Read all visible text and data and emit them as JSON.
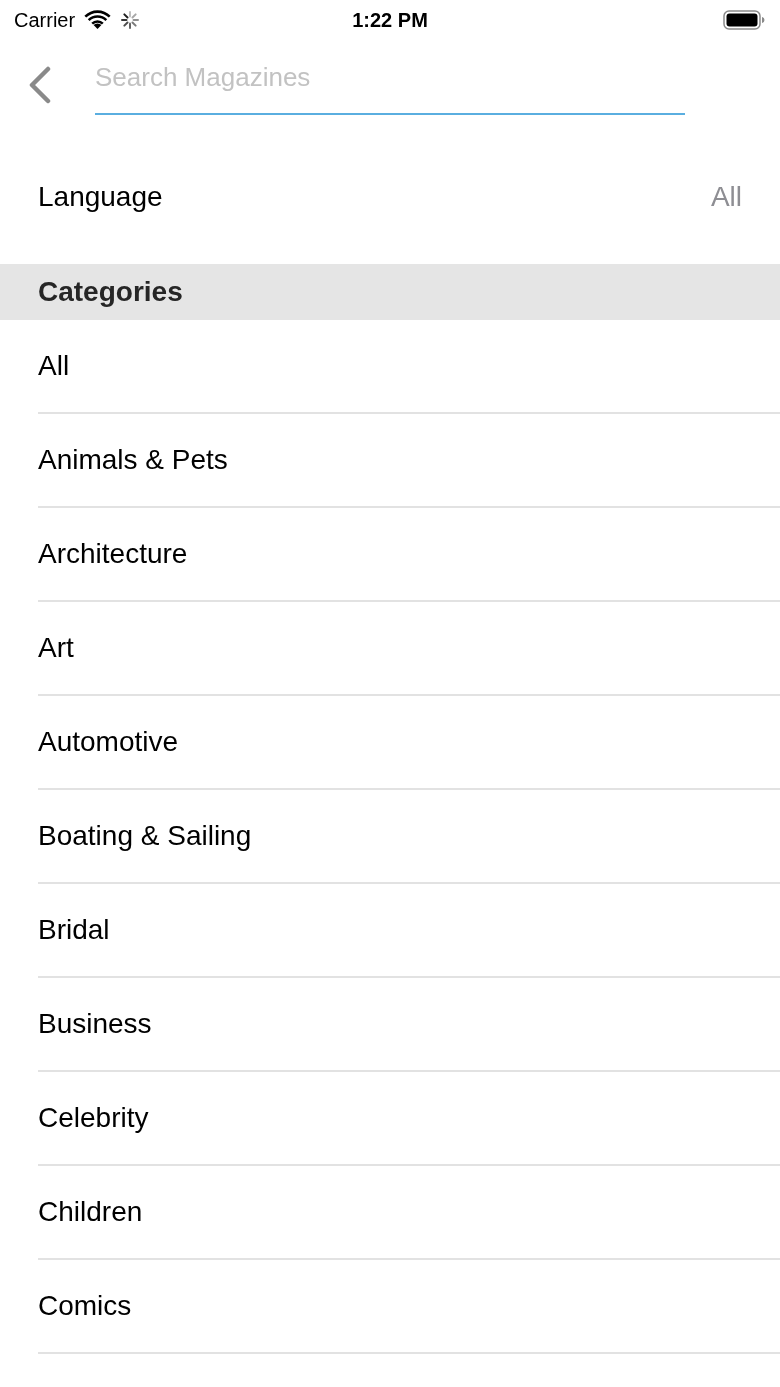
{
  "status_bar": {
    "carrier": "Carrier",
    "time": "1:22 PM"
  },
  "header": {
    "search": {
      "placeholder": "Search Magazines"
    }
  },
  "language": {
    "label": "Language",
    "value": "All"
  },
  "categories": {
    "title": "Categories",
    "items": [
      {
        "label": "All"
      },
      {
        "label": "Animals & Pets"
      },
      {
        "label": "Architecture"
      },
      {
        "label": "Art"
      },
      {
        "label": "Automotive"
      },
      {
        "label": "Boating & Sailing"
      },
      {
        "label": "Bridal"
      },
      {
        "label": "Business"
      },
      {
        "label": "Celebrity"
      },
      {
        "label": "Children"
      },
      {
        "label": "Comics"
      }
    ]
  }
}
